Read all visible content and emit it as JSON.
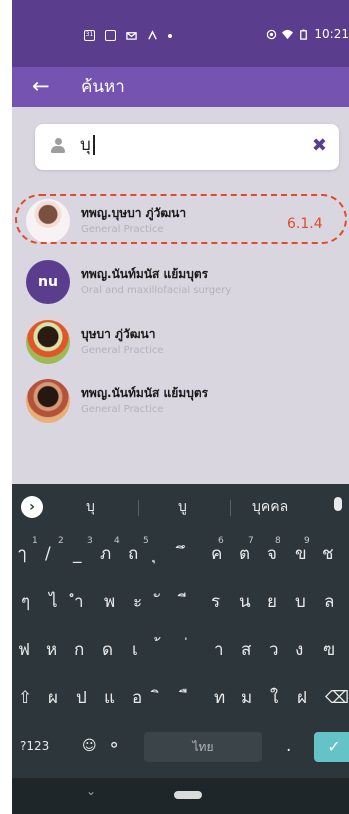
{
  "status_bar": {
    "left_icons": [
      "calendar-icon",
      "sheet-icon",
      "mail-icon",
      "vpn-icon",
      "dot-icon"
    ],
    "right_icons": [
      "cast-icon",
      "wifi-icon",
      "battery-icon"
    ],
    "calendar_day": "31",
    "time": "10:21"
  },
  "app_bar": {
    "title": "ค้นหา",
    "back_icon": "arrow-left-icon"
  },
  "search": {
    "query": "บุ",
    "clear_icon": "close-x-icon"
  },
  "results": [
    {
      "name": "ทพญ.บุษบา ภู่วัฒนา",
      "specialty": "General Practice",
      "avatar": "photo"
    },
    {
      "name": "ทพญ.นันท์มนัส แย้มบุตร",
      "specialty": "Oral and maxillofacial surgery",
      "avatar": "initials",
      "initials": "nu"
    },
    {
      "name": "บุษบา ภู่วัฒนา",
      "specialty": "General Practice",
      "avatar": "photo"
    },
    {
      "name": "ทพญ.นันท์มนัส แย้มบุตร",
      "specialty": "General Practice",
      "avatar": "photo"
    }
  ],
  "annotation": "6.1.4",
  "keyboard": {
    "suggestions": [
      "บุ",
      "บู",
      "บุคคล"
    ],
    "row1": [
      "ๅ",
      "/",
      "_",
      "ภ",
      "ถ",
      "ุ",
      "ึ",
      "ค",
      "ต",
      "จ",
      "ข",
      "ช"
    ],
    "row1_sup": [
      "1",
      "2",
      "3",
      "4",
      "5",
      "6",
      "7",
      "8",
      "9"
    ],
    "row2": [
      "ๆ",
      "ไ",
      "ำ",
      "พ",
      "ะ",
      "ั",
      "ี",
      "ร",
      "น",
      "ย",
      "บ",
      "ล"
    ],
    "row3": [
      "ฟ",
      "ห",
      "ก",
      "ด",
      "เ",
      "้",
      "่",
      "า",
      "ส",
      "ว",
      "ง",
      "ฃ"
    ],
    "row4": [
      "ผ",
      "ป",
      "แ",
      "อ",
      "ิ",
      "ื",
      "ท",
      "ม",
      "ใ",
      "ฝ"
    ],
    "symbols_key": "?123",
    "space_label": "ไทย",
    "period": "."
  },
  "colors": {
    "status_bar": "#5b3d8e",
    "app_bar": "#7553b1",
    "accent": "#5b3d8e",
    "annotation": "#e24a2c"
  }
}
